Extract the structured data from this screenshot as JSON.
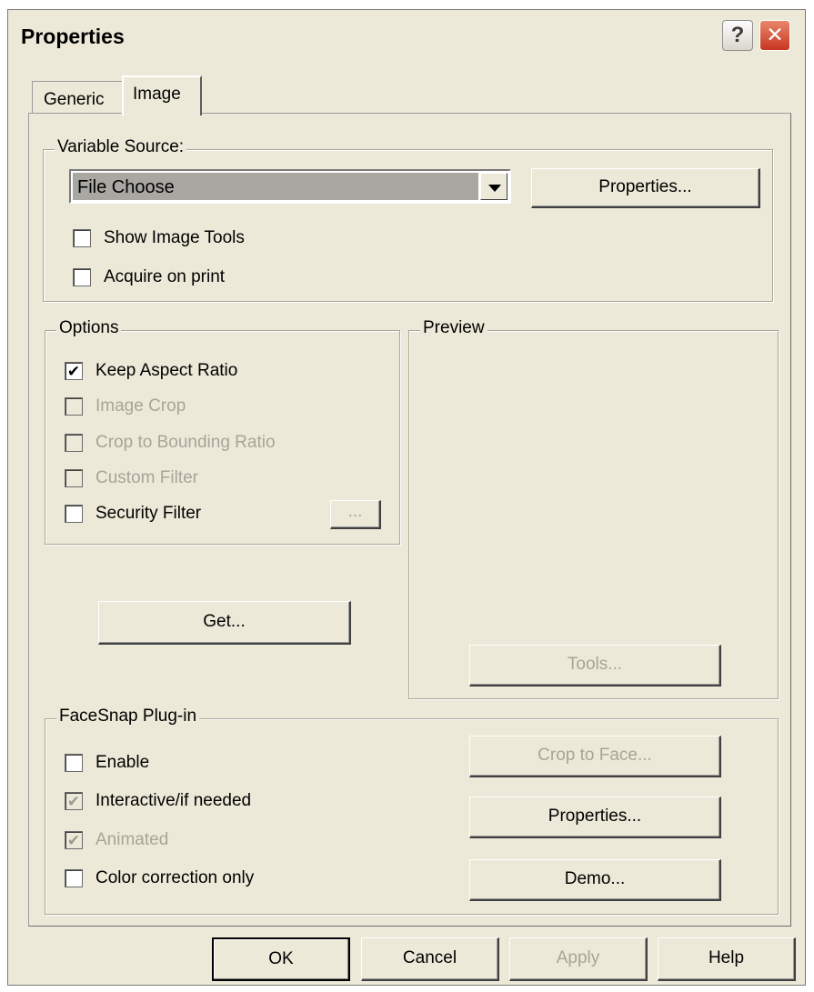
{
  "window": {
    "title": "Properties",
    "help_glyph": "?",
    "close_glyph": "✕"
  },
  "tabs": [
    {
      "label": "Generic",
      "active": false
    },
    {
      "label": "Image",
      "active": true
    }
  ],
  "variable_source": {
    "legend": "Variable Source:",
    "selected": "File Choose",
    "properties_button": "Properties...",
    "checkboxes": [
      {
        "label": "Show Image Tools",
        "checked": false,
        "enabled": true
      },
      {
        "label": "Acquire on print",
        "checked": false,
        "enabled": true
      }
    ]
  },
  "options": {
    "legend": "Options",
    "checkboxes": [
      {
        "label": "Keep Aspect Ratio",
        "checked": true,
        "enabled": true
      },
      {
        "label": "Image Crop",
        "checked": false,
        "enabled": false
      },
      {
        "label": "Crop to Bounding Ratio",
        "checked": false,
        "enabled": false
      },
      {
        "label": "Custom Filter",
        "checked": false,
        "enabled": false
      },
      {
        "label": "Security Filter",
        "checked": false,
        "enabled": true
      }
    ],
    "security_filter_button": "..."
  },
  "get_button": "Get...",
  "preview": {
    "legend": "Preview",
    "tools_button": "Tools..."
  },
  "facesnap": {
    "legend": "FaceSnap Plug-in",
    "checkboxes": [
      {
        "label": "Enable",
        "checked": false,
        "enabled": true
      },
      {
        "label": "Interactive/if needed",
        "checked": true,
        "enabled": false
      },
      {
        "label": "Animated",
        "checked": true,
        "enabled": false
      },
      {
        "label": "Color correction only",
        "checked": false,
        "enabled": true
      }
    ],
    "crop_to_face_button": "Crop to Face...",
    "properties_button": "Properties...",
    "demo_button": "Demo..."
  },
  "footer": {
    "ok": "OK",
    "cancel": "Cancel",
    "apply": "Apply",
    "help": "Help"
  },
  "check_glyph": "✔"
}
